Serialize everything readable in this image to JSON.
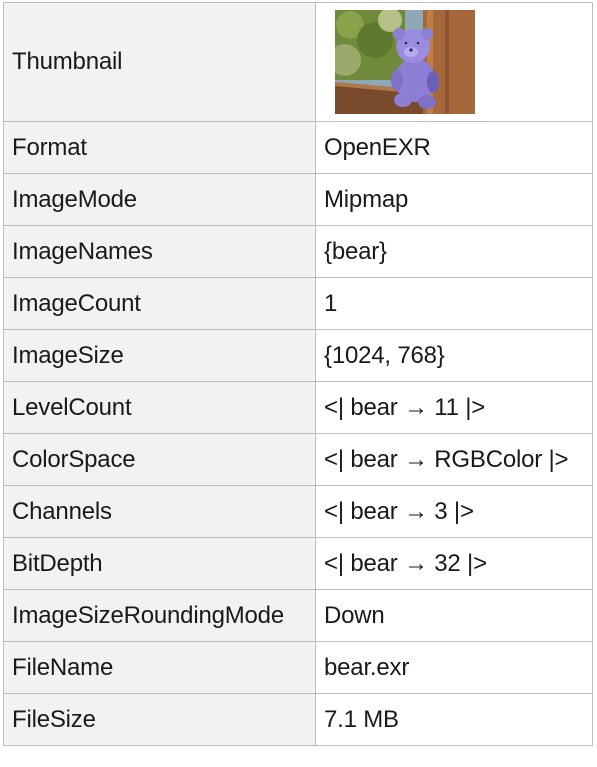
{
  "rows": [
    {
      "key": "Thumbnail"
    },
    {
      "key": "Format",
      "value": "OpenEXR"
    },
    {
      "key": "ImageMode",
      "value": "Mipmap"
    },
    {
      "key": "ImageNames",
      "value": "{bear}"
    },
    {
      "key": "ImageCount",
      "value": "1"
    },
    {
      "key": "ImageSize",
      "value": "{1024, 768}"
    },
    {
      "key": "LevelCount",
      "value": "<| bear → 11 |>"
    },
    {
      "key": "ColorSpace",
      "value": "<| bear → RGBColor |>"
    },
    {
      "key": "Channels",
      "value": "<| bear → 3 |>"
    },
    {
      "key": "BitDepth",
      "value": "<| bear → 32 |>"
    },
    {
      "key": "ImageSizeRoundingMode",
      "value": "Down"
    },
    {
      "key": "FileName",
      "value": "bear.exr"
    },
    {
      "key": "FileSize",
      "value": "7.1 MB"
    }
  ],
  "thumbnail": {
    "description_icon": "teddy-bear-thumbnail",
    "colors": {
      "sky": "#8fa8b8",
      "foliage": "#6f8a3a",
      "wood": "#a5683a",
      "bear": "#8d7fd6",
      "bear_shadow": "#6c5fb8",
      "shelf": "#7a4a2c"
    }
  }
}
